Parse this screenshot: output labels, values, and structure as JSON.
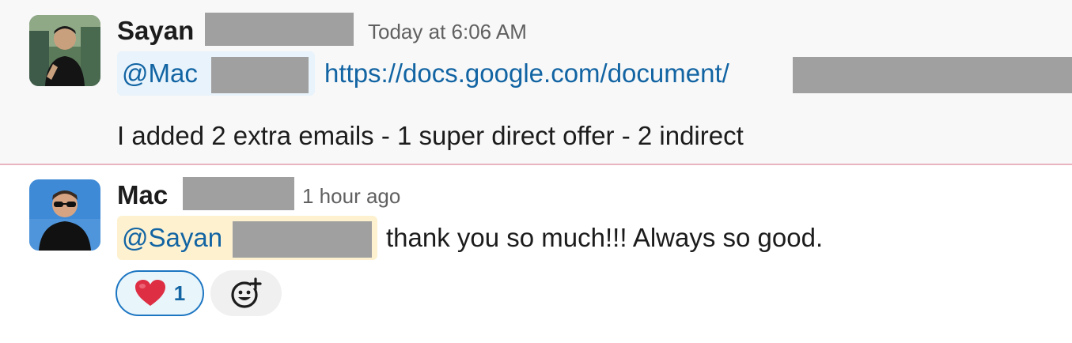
{
  "messages": [
    {
      "author": "Sayan",
      "timestamp": "Today at 6:06 AM",
      "mention": "@Mac",
      "link": "https://docs.google.com/document/",
      "text": "I added 2 extra emails - 1 super direct offer - 2 indirect"
    },
    {
      "author": "Mac",
      "timestamp": "1 hour ago",
      "mention": "@Sayan",
      "text": "thank you so much!!! Always so good.",
      "reactions": [
        {
          "emoji": "red-heart",
          "count": "1"
        }
      ]
    }
  ],
  "colors": {
    "link": "#1264a3",
    "mention_bg_blue": "#e8f3fb",
    "mention_bg_yellow": "#fdf1d0",
    "reaction_border": "#1d76c2",
    "new_divider": "#e8b4c0"
  },
  "icons": {
    "add_reaction": "add-reaction-icon",
    "heart": "heart-icon"
  }
}
